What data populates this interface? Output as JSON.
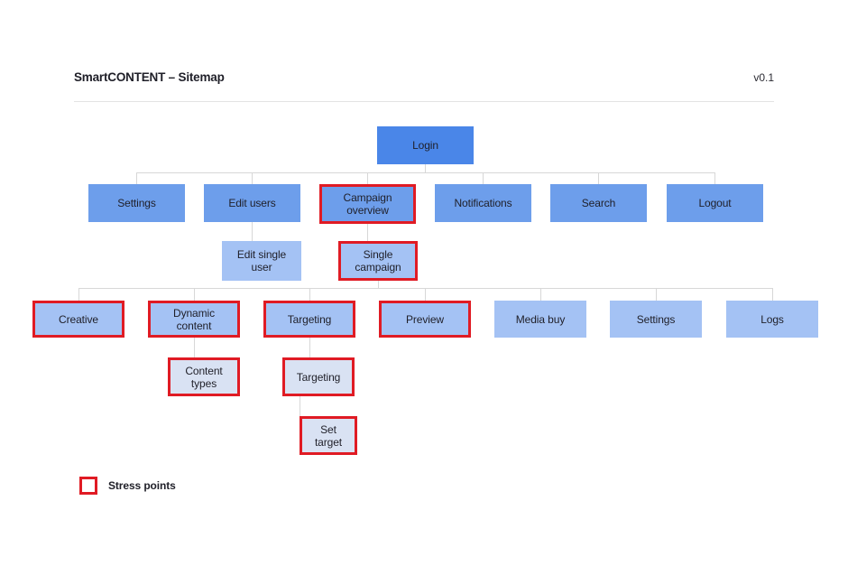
{
  "header": {
    "title": "SmartCONTENT – Sitemap",
    "version": "v0.1"
  },
  "legend": {
    "label": "Stress points",
    "swatch_name": "stress-point-swatch",
    "stress_color": "#e01b24"
  },
  "colors": {
    "level1_fill": "#4a86e8",
    "level2_fill": "#6d9eeb",
    "level3_fill": "#a4c2f4",
    "level4_fill": "#a4c2f4",
    "level5_fill": "#d9e2f3",
    "stress_border": "#e01b24",
    "connector": "#d7d7d7",
    "rule": "#e3e3e3",
    "text": "#1f1f28"
  },
  "nodes": {
    "login": "Login",
    "settings_top": "Settings",
    "edit_users": "Edit users",
    "campaign_overview": "Campaign\noverview",
    "notifications": "Notifications",
    "search": "Search",
    "logout": "Logout",
    "edit_single_user": "Edit single\nuser",
    "single_campaign": "Single\ncampaign",
    "creative": "Creative",
    "dynamic_content": "Dynamic\ncontent",
    "targeting": "Targeting",
    "preview": "Preview",
    "media_buy": "Media buy",
    "settings_campaign": "Settings",
    "logs": "Logs",
    "content_types": "Content\ntypes",
    "targeting_child": "Targeting",
    "set_target": "Set\ntarget"
  },
  "tree": [
    {
      "id": "login",
      "label": "Login",
      "level": 1,
      "stress": false,
      "children": [
        {
          "id": "settings_top",
          "label": "Settings",
          "level": 2,
          "stress": false,
          "children": []
        },
        {
          "id": "edit_users",
          "label": "Edit users",
          "level": 2,
          "stress": false,
          "children": [
            {
              "id": "edit_single_user",
              "label": "Edit single user",
              "level": 3,
              "stress": false,
              "children": []
            }
          ]
        },
        {
          "id": "campaign_overview",
          "label": "Campaign overview",
          "level": 2,
          "stress": true,
          "children": [
            {
              "id": "single_campaign",
              "label": "Single campaign",
              "level": 3,
              "stress": true,
              "children": [
                {
                  "id": "creative",
                  "label": "Creative",
                  "level": 4,
                  "stress": true,
                  "children": []
                },
                {
                  "id": "dynamic_content",
                  "label": "Dynamic content",
                  "level": 4,
                  "stress": true,
                  "children": [
                    {
                      "id": "content_types",
                      "label": "Content types",
                      "level": 5,
                      "stress": true,
                      "children": []
                    }
                  ]
                },
                {
                  "id": "targeting",
                  "label": "Targeting",
                  "level": 4,
                  "stress": true,
                  "children": [
                    {
                      "id": "targeting_child",
                      "label": "Targeting",
                      "level": 5,
                      "stress": true,
                      "children": [
                        {
                          "id": "set_target",
                          "label": "Set target",
                          "level": 5,
                          "stress": true,
                          "children": []
                        }
                      ]
                    }
                  ]
                },
                {
                  "id": "preview",
                  "label": "Preview",
                  "level": 4,
                  "stress": true,
                  "children": []
                },
                {
                  "id": "media_buy",
                  "label": "Media buy",
                  "level": 4,
                  "stress": false,
                  "children": []
                },
                {
                  "id": "settings_campaign",
                  "label": "Settings",
                  "level": 4,
                  "stress": false,
                  "children": []
                },
                {
                  "id": "logs",
                  "label": "Logs",
                  "level": 4,
                  "stress": false,
                  "children": []
                }
              ]
            }
          ]
        },
        {
          "id": "notifications",
          "label": "Notifications",
          "level": 2,
          "stress": false,
          "children": []
        },
        {
          "id": "search",
          "label": "Search",
          "level": 2,
          "stress": false,
          "children": []
        },
        {
          "id": "logout",
          "label": "Logout",
          "level": 2,
          "stress": false,
          "children": []
        }
      ]
    }
  ]
}
